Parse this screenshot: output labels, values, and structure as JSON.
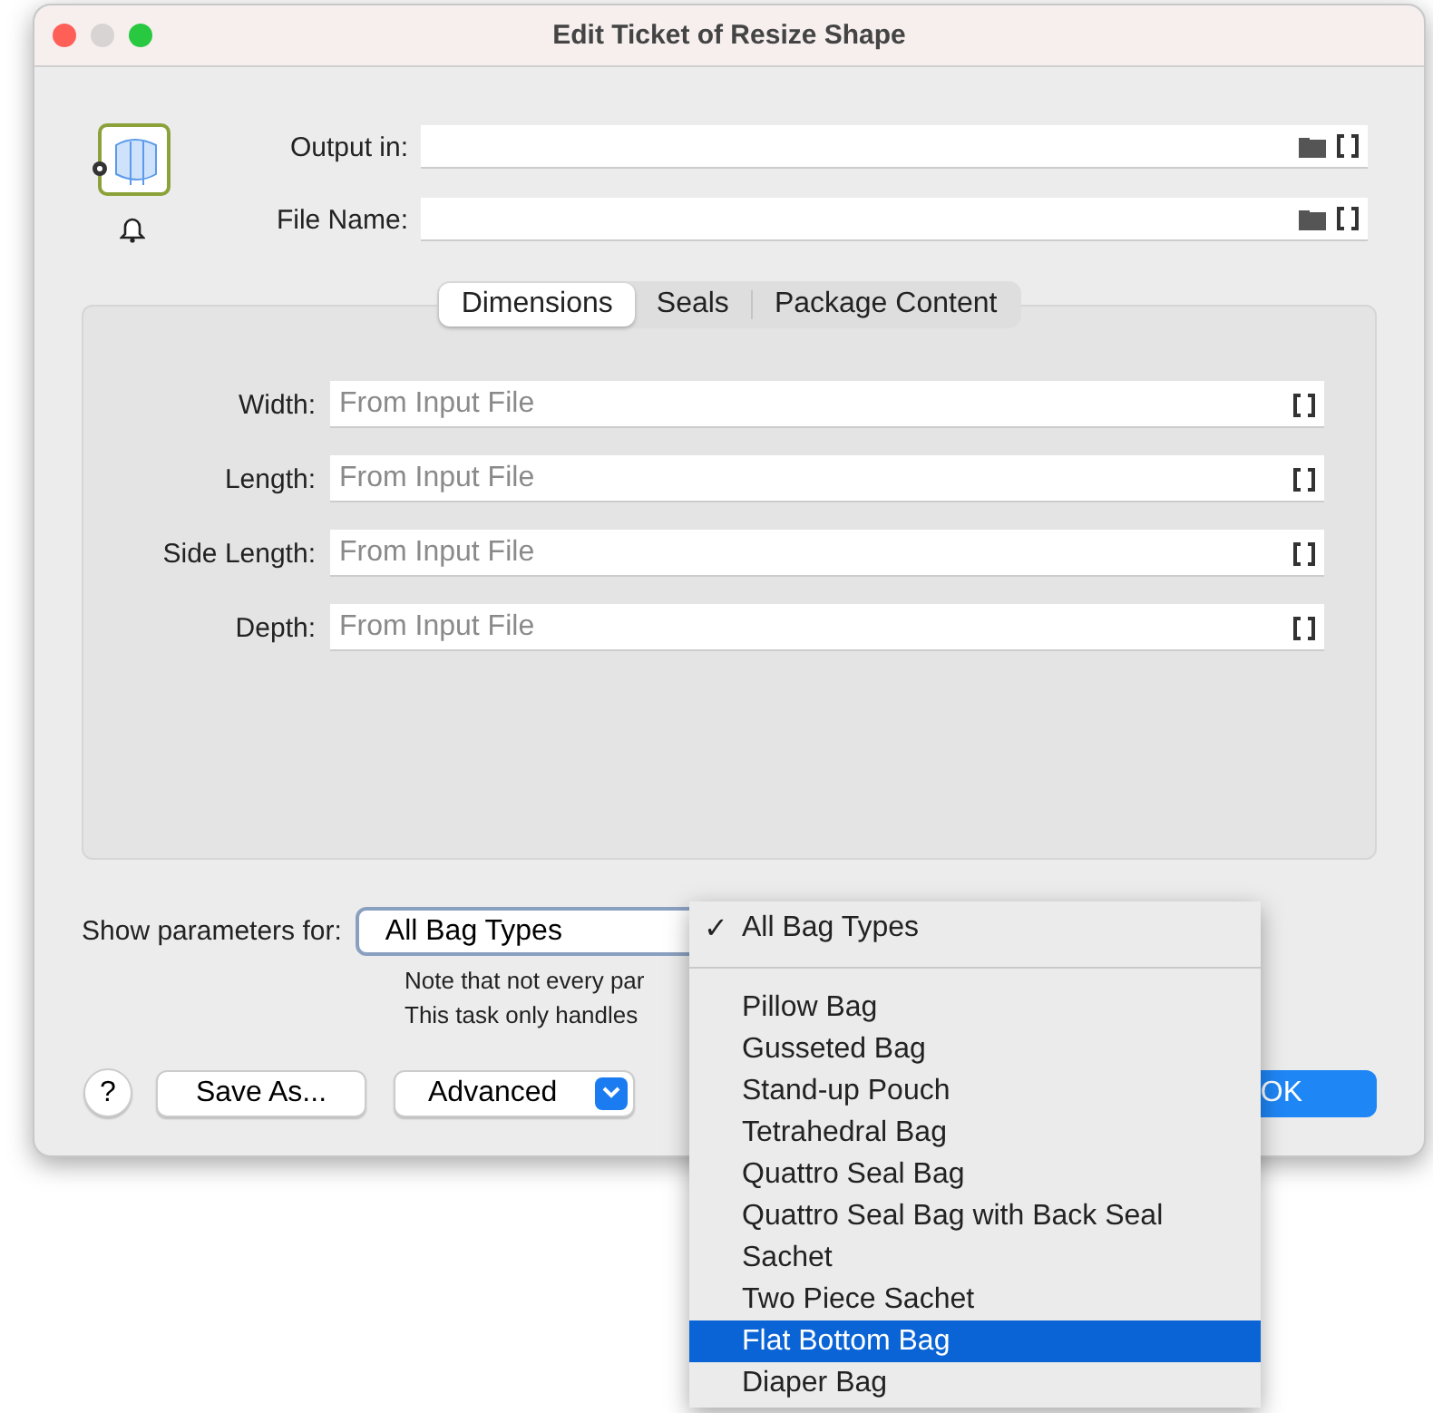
{
  "window": {
    "title": "Edit Ticket of Resize Shape"
  },
  "output_fields": [
    {
      "label": "Output in:"
    },
    {
      "label": "File Name:"
    }
  ],
  "tabs": [
    {
      "label": "Dimensions",
      "selected": true
    },
    {
      "label": "Seals",
      "selected": false
    },
    {
      "label": "Package Content",
      "selected": false
    }
  ],
  "parameters": [
    {
      "label": "Width:",
      "placeholder": "From Input File"
    },
    {
      "label": "Length:",
      "placeholder": "From Input File"
    },
    {
      "label": "Side Length:",
      "placeholder": "From Input File"
    },
    {
      "label": "Depth:",
      "placeholder": "From Input File"
    }
  ],
  "show_parameters": {
    "label": "Show parameters for:",
    "value": "All Bag Types"
  },
  "notes": [
    "Note that not every par",
    "This task only handles"
  ],
  "buttons": [
    {
      "kind": "help",
      "label": "?"
    },
    {
      "kind": "push",
      "label": "Save As..."
    },
    {
      "kind": "menu",
      "label": "Advanced"
    },
    {
      "kind": "default",
      "label": "OK"
    }
  ],
  "menu": {
    "check_glyph": "✓",
    "items": [
      {
        "kind": "option",
        "label": "All Bag Types",
        "checked": true,
        "selected": false
      },
      {
        "kind": "separator"
      },
      {
        "kind": "option",
        "label": "Pillow Bag",
        "checked": false,
        "selected": false
      },
      {
        "kind": "option",
        "label": "Gusseted Bag",
        "checked": false,
        "selected": false
      },
      {
        "kind": "option",
        "label": "Stand-up Pouch",
        "checked": false,
        "selected": false
      },
      {
        "kind": "option",
        "label": "Tetrahedral Bag",
        "checked": false,
        "selected": false
      },
      {
        "kind": "option",
        "label": "Quattro Seal Bag",
        "checked": false,
        "selected": false
      },
      {
        "kind": "option",
        "label": "Quattro Seal Bag with Back Seal",
        "checked": false,
        "selected": false
      },
      {
        "kind": "option",
        "label": "Sachet",
        "checked": false,
        "selected": false
      },
      {
        "kind": "option",
        "label": "Two Piece Sachet",
        "checked": false,
        "selected": false
      },
      {
        "kind": "option",
        "label": "Flat Bottom Bag",
        "checked": false,
        "selected": true
      },
      {
        "kind": "option",
        "label": "Diaper Bag",
        "checked": false,
        "selected": false
      }
    ]
  }
}
